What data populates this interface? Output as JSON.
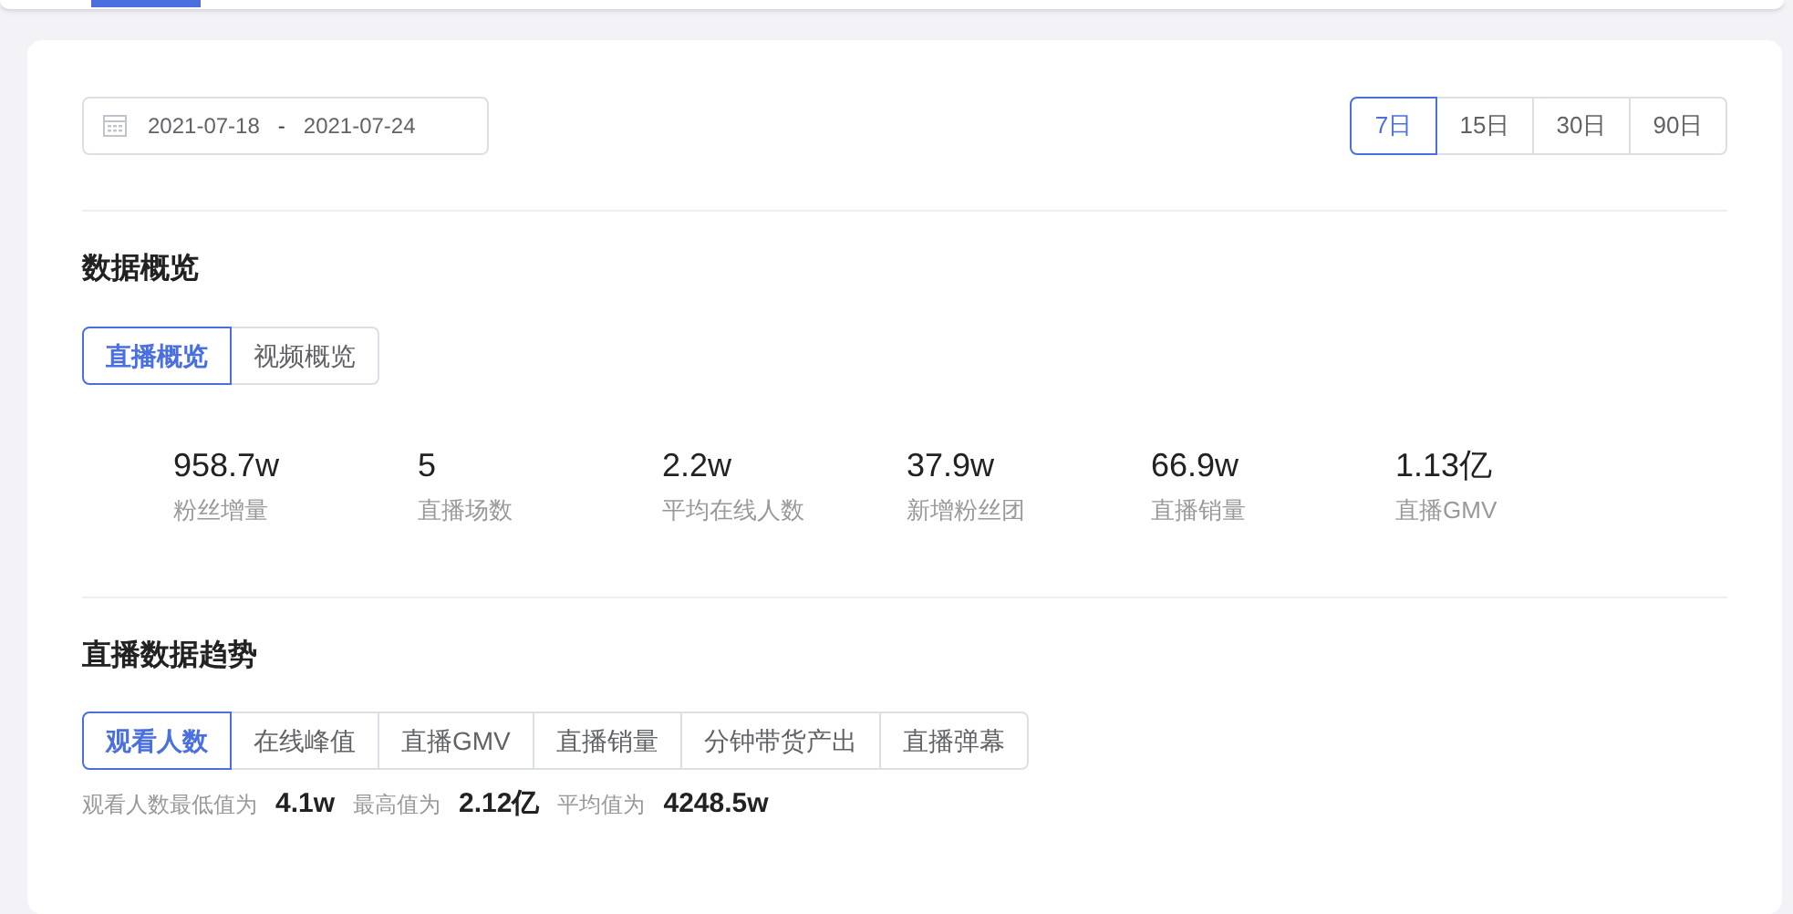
{
  "date_range": {
    "start": "2021-07-18",
    "separator": "-",
    "end": "2021-07-24"
  },
  "period_buttons": [
    {
      "label": "7日",
      "selected": true
    },
    {
      "label": "15日",
      "selected": false
    },
    {
      "label": "30日",
      "selected": false
    },
    {
      "label": "90日",
      "selected": false
    }
  ],
  "overview": {
    "title": "数据概览",
    "tabs": [
      {
        "label": "直播概览",
        "selected": true
      },
      {
        "label": "视频概览",
        "selected": false
      }
    ],
    "stats": [
      {
        "value": "958.7w",
        "label": "粉丝增量"
      },
      {
        "value": "5",
        "label": "直播场数"
      },
      {
        "value": "2.2w",
        "label": "平均在线人数"
      },
      {
        "value": "37.9w",
        "label": "新增粉丝团"
      },
      {
        "value": "66.9w",
        "label": "直播销量"
      },
      {
        "value": "1.13亿",
        "label": "直播GMV"
      }
    ]
  },
  "trend": {
    "title": "直播数据趋势",
    "tabs": [
      {
        "label": "观看人数",
        "selected": true
      },
      {
        "label": "在线峰值",
        "selected": false
      },
      {
        "label": "直播GMV",
        "selected": false
      },
      {
        "label": "直播销量",
        "selected": false
      },
      {
        "label": "分钟带货产出",
        "selected": false
      },
      {
        "label": "直播弹幕",
        "selected": false
      }
    ],
    "summary": [
      {
        "label": "观看人数最低值为",
        "value": "4.1w"
      },
      {
        "label": "最高值为",
        "value": "2.12亿"
      },
      {
        "label": "平均值为",
        "value": "4248.5w"
      }
    ]
  }
}
